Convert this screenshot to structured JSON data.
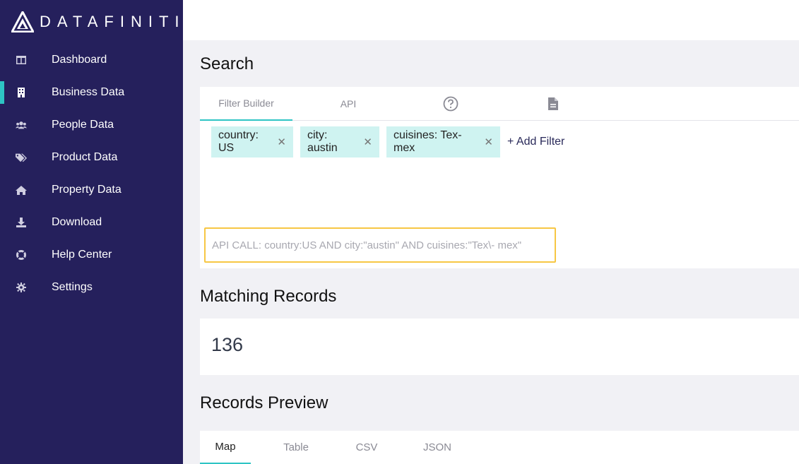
{
  "brand": {
    "name": "DATAFINITI"
  },
  "sidebar": {
    "items": [
      {
        "label": "Dashboard",
        "icon": "dashboard-icon"
      },
      {
        "label": "Business Data",
        "icon": "building-icon",
        "active": true
      },
      {
        "label": "People Data",
        "icon": "people-icon"
      },
      {
        "label": "Product Data",
        "icon": "tags-icon"
      },
      {
        "label": "Property Data",
        "icon": "home-icon"
      },
      {
        "label": "Download",
        "icon": "download-icon"
      },
      {
        "label": "Help Center",
        "icon": "lifebuoy-icon"
      },
      {
        "label": "Settings",
        "icon": "gear-icon"
      }
    ]
  },
  "search": {
    "title": "Search",
    "tabs": [
      "Filter Builder",
      "API"
    ],
    "active_tab": "Filter Builder",
    "tab_icons": [
      "help-circle-icon",
      "document-icon"
    ],
    "filters": [
      "country: US",
      "city: austin",
      "cuisines: Tex-mex"
    ],
    "add_filter_label": "+ Add Filter",
    "api_call": "API CALL: country:US AND city:\"austin\" AND cuisines:\"Tex\\- mex\""
  },
  "matching": {
    "title": "Matching Records",
    "count": "136"
  },
  "preview": {
    "title": "Records Preview",
    "tabs": [
      "Map",
      "Table",
      "CSV",
      "JSON"
    ],
    "active_tab": "Map"
  },
  "colors": {
    "sidebar_bg": "#25205c",
    "accent": "#2ec4c4",
    "chip_bg": "#cff3f1",
    "highlight_border": "#f7c744"
  }
}
